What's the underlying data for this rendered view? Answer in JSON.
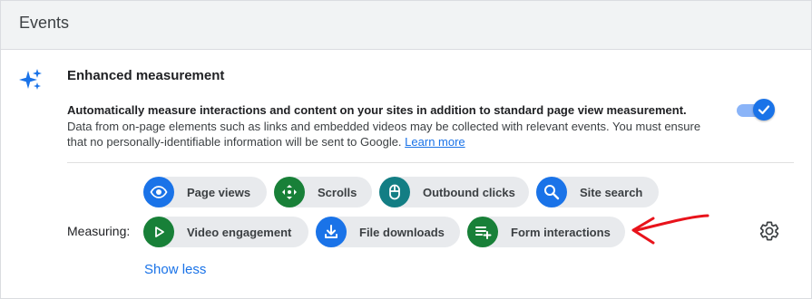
{
  "header": {
    "title": "Events"
  },
  "section": {
    "title": "Enhanced measurement",
    "description_lead": "Automatically measure interactions and content on your sites in addition to standard page view measurement.",
    "description_body": "Data from on-page elements such as links and embedded videos may be collected with relevant events. You must ensure that no personally-identifiable information will be sent to Google.",
    "learn_more": "Learn more",
    "toggle_on": true
  },
  "measuring": {
    "label": "Measuring:",
    "chips": [
      {
        "label": "Page views",
        "icon": "eye-icon",
        "color": "#1a73e8"
      },
      {
        "label": "Scrolls",
        "icon": "scroll-arrows-icon",
        "color": "#188038"
      },
      {
        "label": "Outbound clicks",
        "icon": "mouse-icon",
        "color": "#137e84"
      },
      {
        "label": "Site search",
        "icon": "search-icon",
        "color": "#1a73e8"
      },
      {
        "label": "Video engagement",
        "icon": "play-icon",
        "color": "#188038"
      },
      {
        "label": "File downloads",
        "icon": "download-icon",
        "color": "#1a73e8"
      },
      {
        "label": "Form interactions",
        "icon": "playlist-add-icon",
        "color": "#188038"
      }
    ],
    "show_less": "Show less"
  },
  "annotation_color": "#e8131b"
}
